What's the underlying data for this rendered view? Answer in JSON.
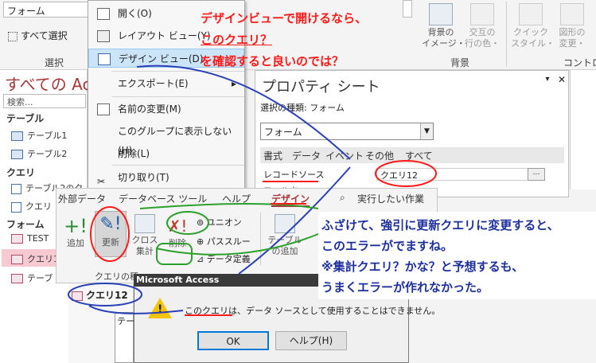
{
  "ribbon": {
    "form_combo_value": "フォーム",
    "select_all_label": "すべて選択",
    "select_group_label": "選択",
    "bg_image_label": "背景の\nイメージ・",
    "alt_row_color_label": "交互の\n行の色・",
    "bg_group_label": "背景",
    "quick_style_label": "クイック\nスタイル・",
    "change_shape_label": "図形の\n変更・",
    "control_group_label": "コントロ"
  },
  "nav": {
    "title": "すべての Acc",
    "search_placeholder": "検索...",
    "sections": [
      {
        "header": "テーブル",
        "items": [
          "テーブル1",
          "テーブル2"
        ]
      },
      {
        "header": "クエリ",
        "items": [
          "テーブル2のク",
          "クエリ"
        ]
      },
      {
        "header": "フォーム",
        "items": [
          "TEST",
          "クエリ1",
          "テーブ"
        ]
      }
    ]
  },
  "context_menu": {
    "items": [
      "開く(O)",
      "レイアウト ビュー(Y)",
      "デザイン ビュー(D)",
      "エクスポート(E)",
      "名前の変更(M)",
      "このグループに表示しない(H)",
      "削除(L)",
      "切り取り(T)"
    ]
  },
  "property_sheet": {
    "title": "プロパティ シート",
    "selection_type_label": "選択の種類: フォーム",
    "object_select_value": "フォーム",
    "tabs": [
      "書式",
      "データ",
      "イベント",
      "その他",
      "すべて"
    ],
    "record_source_label": "レコードソース",
    "record_source_value": "クエリ12",
    "row2_label": "フィルター"
  },
  "design_ribbon": {
    "tabs": [
      "外部データ",
      "データベース ツール",
      "ヘルプ",
      "デザイン",
      "実行したい作業"
    ],
    "buttons": {
      "add": "追加",
      "update": "更新",
      "crosstab": "クロス\n集計",
      "delete": "削除",
      "union": "ユニオン",
      "passthrough": "パススルー",
      "data_definition": "データ定義",
      "table_add": "テーブル\nの追加"
    },
    "query_type_label": "クエリの種",
    "query_tab": "クエリ12",
    "field_list_title": "テー"
  },
  "dialog": {
    "title": "Microsoft Access",
    "message": "このクエリは、データ ソースとして使用することはできません。",
    "ok_label": "OK",
    "help_label": "ヘルプ(H)"
  },
  "annotations": {
    "top_lines": [
      "デザインビューで開けるなら、",
      "このクエリ？",
      "を確認すると良いのでは？"
    ],
    "bottom_lines": [
      "ふざけて、強引に更新クエリに変更すると、",
      "このエラーがでますね。",
      "※集計クエリ？かな？と予想するも、",
      "うまくエラーが作れなかった。"
    ]
  },
  "colors": {
    "annotation_red": "#ff1a1a",
    "annotation_blue": "#1e2f9e",
    "highlight_pink": "#f7c9d1",
    "design_tab_red": "#a4373a"
  }
}
